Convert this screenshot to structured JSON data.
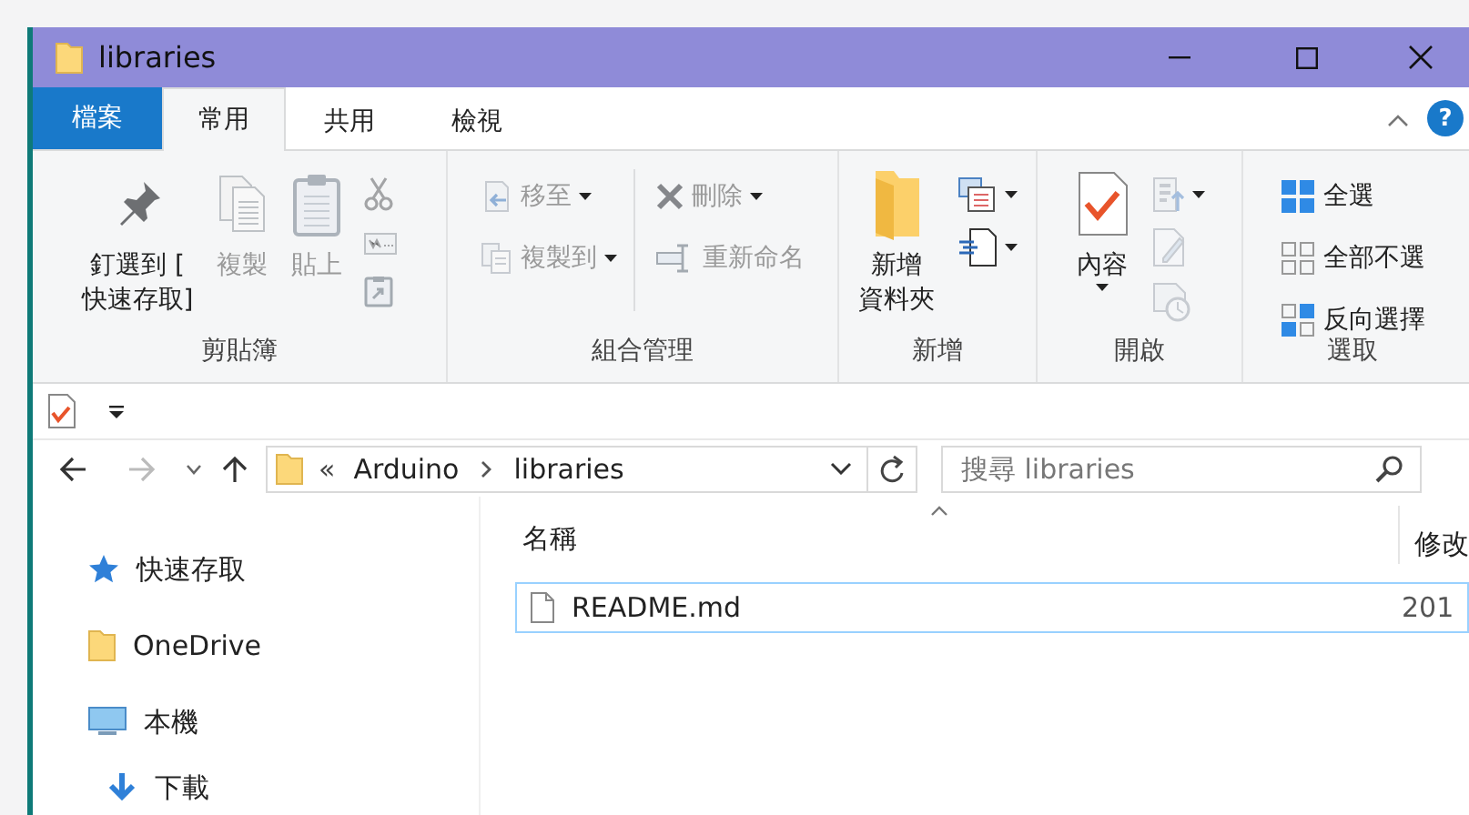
{
  "window": {
    "title": "libraries"
  },
  "tabs": [
    {
      "label": "檔案",
      "kind": "file",
      "selected": false
    },
    {
      "label": "常用",
      "kind": "tab",
      "selected": true
    },
    {
      "label": "共用",
      "kind": "tab",
      "selected": false
    },
    {
      "label": "檢視",
      "kind": "tab",
      "selected": false
    }
  ],
  "help": "?",
  "ribbon": {
    "groups": [
      {
        "label": "剪貼簿",
        "items": [
          {
            "kind": "large",
            "lines": [
              "釘選到 [",
              "快速存取]"
            ],
            "disabled": false,
            "dropdown": false
          },
          {
            "kind": "large",
            "lines": [
              "複製"
            ],
            "disabled": true,
            "dropdown": false
          },
          {
            "kind": "large",
            "lines": [
              "貼上"
            ],
            "disabled": true,
            "dropdown": false
          },
          {
            "kind": "stack",
            "items": [
              {
                "kind": "icon",
                "disabled": true,
                "dropdown": false
              },
              {
                "kind": "icon",
                "disabled": true,
                "dropdown": false
              },
              {
                "kind": "icon",
                "disabled": true,
                "dropdown": false
              }
            ]
          }
        ]
      },
      {
        "label": "組合管理",
        "items": [
          {
            "kind": "stack",
            "items": [
              {
                "kind": "small",
                "label": "移至",
                "disabled": true,
                "dropdown": true
              },
              {
                "kind": "small",
                "label": "複製到",
                "disabled": true,
                "dropdown": true
              }
            ]
          },
          {
            "kind": "stack",
            "items": [
              {
                "kind": "small",
                "label": "刪除",
                "disabled": true,
                "dropdown": true
              },
              {
                "kind": "small",
                "label": "重新命名",
                "disabled": true,
                "dropdown": false
              }
            ]
          }
        ]
      },
      {
        "label": "新增",
        "items": [
          {
            "kind": "large",
            "lines": [
              "新增",
              "資料夾"
            ],
            "disabled": false,
            "dropdown": false
          },
          {
            "kind": "stack",
            "items": [
              {
                "kind": "icon",
                "disabled": false,
                "dropdown": true
              },
              {
                "kind": "icon",
                "disabled": false,
                "dropdown": true
              }
            ]
          }
        ]
      },
      {
        "label": "開啟",
        "items": [
          {
            "kind": "large",
            "lines": [
              "內容"
            ],
            "disabled": false,
            "dropdown": true
          },
          {
            "kind": "stack",
            "items": [
              {
                "kind": "icon",
                "disabled": true,
                "dropdown": true
              },
              {
                "kind": "icon",
                "disabled": true,
                "dropdown": false
              },
              {
                "kind": "icon",
                "disabled": true,
                "dropdown": false
              }
            ]
          }
        ]
      },
      {
        "label": "選取",
        "items": [
          {
            "kind": "stack",
            "items": [
              {
                "kind": "small",
                "label": "全選",
                "disabled": false,
                "dropdown": false
              },
              {
                "kind": "small",
                "label": "全部不選",
                "disabled": false,
                "dropdown": false
              },
              {
                "kind": "small",
                "label": "反向選擇",
                "disabled": false,
                "dropdown": false
              }
            ]
          }
        ]
      }
    ]
  },
  "address": {
    "overflow": "«",
    "segments": [
      "Arduino",
      "libraries"
    ]
  },
  "search": {
    "placeholder": "搜尋 libraries"
  },
  "navigation": [
    {
      "label": "快速存取"
    },
    {
      "label": "OneDrive"
    },
    {
      "label": "本機",
      "children": [
        {
          "label": "下載"
        }
      ]
    }
  ],
  "files": {
    "columns": [
      "名稱",
      "修改"
    ],
    "rows": [
      {
        "cells": [
          "README.md",
          "201"
        ],
        "focused": true
      }
    ]
  }
}
